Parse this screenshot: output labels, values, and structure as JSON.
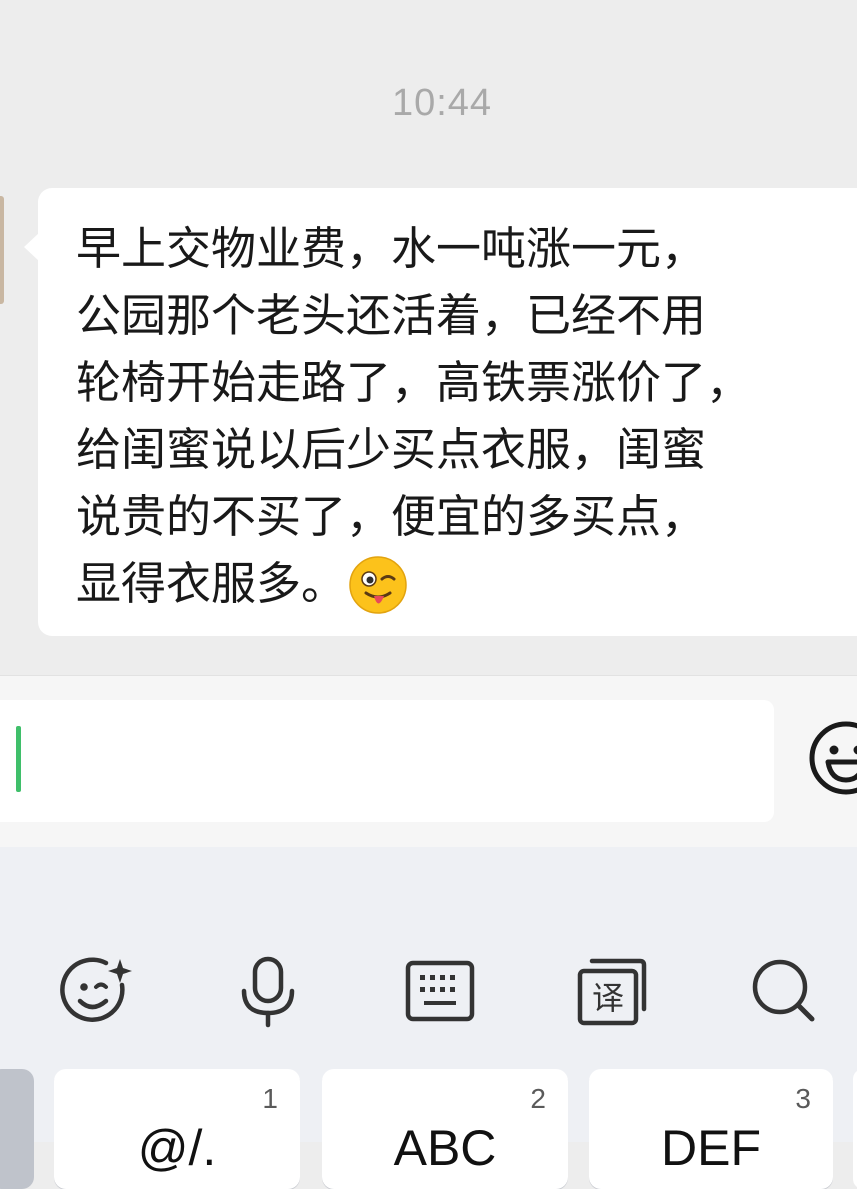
{
  "chat": {
    "timestamp": "10:44",
    "message": {
      "lines": [
        "早上交物业费，水一吨涨一元，",
        "公园那个老头还活着，已经不用",
        "轮椅开始走路了，高铁票涨价了，",
        "给闺蜜说以后少买点衣服，闺蜜",
        "说贵的不买了，便宜的多买点，",
        "显得衣服多。"
      ],
      "emoji": "winking-face-with-tongue"
    }
  },
  "input": {
    "value": "",
    "emoji_button_icon": "smiley-icon"
  },
  "keyboard": {
    "toolbar": [
      {
        "name": "emoji-sticker",
        "icon": "emoji-sparkle-icon"
      },
      {
        "name": "voice-input",
        "icon": "microphone-icon"
      },
      {
        "name": "keyboard-toggle",
        "icon": "keyboard-icon"
      },
      {
        "name": "translate",
        "icon": "translate-icon",
        "glyph": "译"
      },
      {
        "name": "search",
        "icon": "search-icon"
      }
    ],
    "keys": [
      {
        "num": "1",
        "label": "@/."
      },
      {
        "num": "2",
        "label": "ABC"
      },
      {
        "num": "3",
        "label": "DEF"
      }
    ]
  },
  "colors": {
    "chat_bg": "#ededed",
    "bubble": "#ffffff",
    "caret": "#3fbf6a",
    "timestamp": "#a9a9a9",
    "keyboard_bg": "#eef0f4"
  }
}
